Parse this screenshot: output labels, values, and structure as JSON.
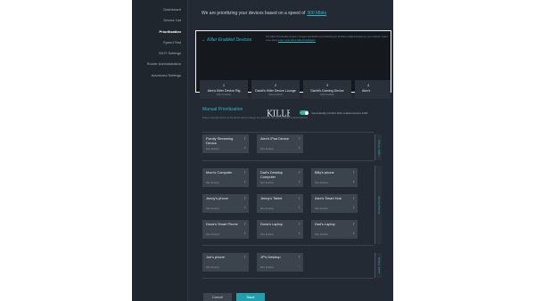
{
  "nav": [
    "Dashboard",
    "Device List",
    "Prioritization",
    "Speed Test",
    "Wi-Fi Settings",
    "Router Administration",
    "Advanced Settings"
  ],
  "top": {
    "prefix": "We are prioritizing your devices based on a speed of",
    "speed": "300 Mbits"
  },
  "killer": {
    "title": "Killer Enabled Devices",
    "description": "The Killer Prioritization Engine manages bandwidth and prioritizing for all Killer-enabled devices on your network. Learn more about",
    "link": "Learn more about Killer Prioritization",
    "devices": [
      {
        "num": "1",
        "name": "Alex's Killer Device Rig",
        "sub": "Killer Enabled"
      },
      {
        "num": "2",
        "name": "David's Killer Device Lounge",
        "sub": "Killer Enabled"
      },
      {
        "num": "3",
        "name": "David's Gaming Device",
        "sub": "Killer Enabled"
      },
      {
        "num": "4",
        "name": "Alex's",
        "sub": ""
      }
    ],
    "logo": "KILLER",
    "toggle_label": "Automatically prioritize Killer enabled devices traffic"
  },
  "manual": {
    "title": "Manual Prioritization",
    "description": "Drag or use the arrows on the device tiles to change the priority tier for your non-Killer enabled devices",
    "tiers": [
      "Higher Priority",
      "Normal Priority",
      "Lower Priority"
    ],
    "devices": [
      {
        "name": "Family Streaming Device",
        "sub": "Killer Enabled"
      },
      {
        "name": "Alex's iPad Device",
        "sub": "Killer Enabled"
      },
      {
        "name": "Mom's Computer",
        "sub": "Killer Enabled"
      },
      {
        "name": "Dad's Desktop Computer",
        "sub": "Killer Enabled"
      },
      {
        "name": "Billy's phone",
        "sub": "Killer Enabled"
      },
      {
        "name": "Jenny's phone",
        "sub": "Killer Enabled"
      },
      {
        "name": "Jenny's Tablet",
        "sub": "Killer Enabled"
      },
      {
        "name": "Alex's Smart Hub",
        "sub": "Killer Enabled"
      },
      {
        "name": "Dona's Smart Phone",
        "sub": "Killer Enabled"
      },
      {
        "name": "Dona's Laptop",
        "sub": "Killer Enabled"
      },
      {
        "name": "Dad's Laptop",
        "sub": "Killer Enabled"
      },
      {
        "name": "Joe's phone",
        "sub": "Killer Enabled"
      },
      {
        "name": "JP's Desktop",
        "sub": "Killer Enabled"
      }
    ]
  },
  "buttons": {
    "cancel": "Cancel",
    "save": "Save"
  },
  "colors": {
    "accent": "#2bb7c7",
    "background": "#232a33",
    "tile": "#3b434c",
    "toggle_on": "#2bb78a",
    "down_red": "#d84a4a"
  }
}
